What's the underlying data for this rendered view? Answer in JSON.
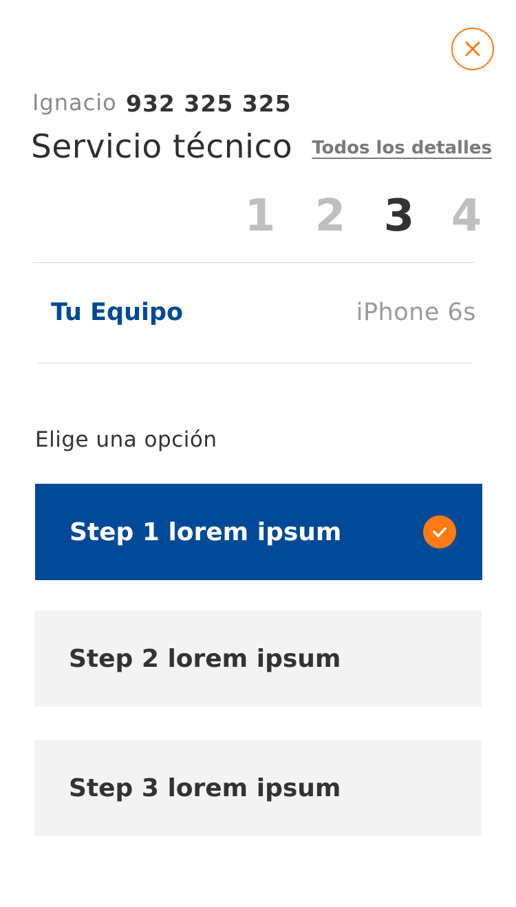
{
  "header": {
    "close_icon": "close-icon",
    "user_name": "Ignacio",
    "user_phone": "932 325 325",
    "title": "Servicio técnico",
    "details_link": "Todos los detalles"
  },
  "steps": {
    "items": [
      "1",
      "2",
      "3",
      "4"
    ],
    "current": 3
  },
  "device": {
    "label": "Tu Equipo",
    "value": "iPhone 6s"
  },
  "options": {
    "prompt": "Elige una opción",
    "items": [
      {
        "label": "Step 1 lorem ipsum",
        "selected": true
      },
      {
        "label": "Step 2 lorem ipsum",
        "selected": false
      },
      {
        "label": "Step 3 lorem ipsum",
        "selected": false
      }
    ],
    "selected_icon": "check-icon"
  },
  "colors": {
    "accent": "#ff7a14",
    "brand_blue": "#004a97",
    "option_bg": "#f3f3f3"
  }
}
